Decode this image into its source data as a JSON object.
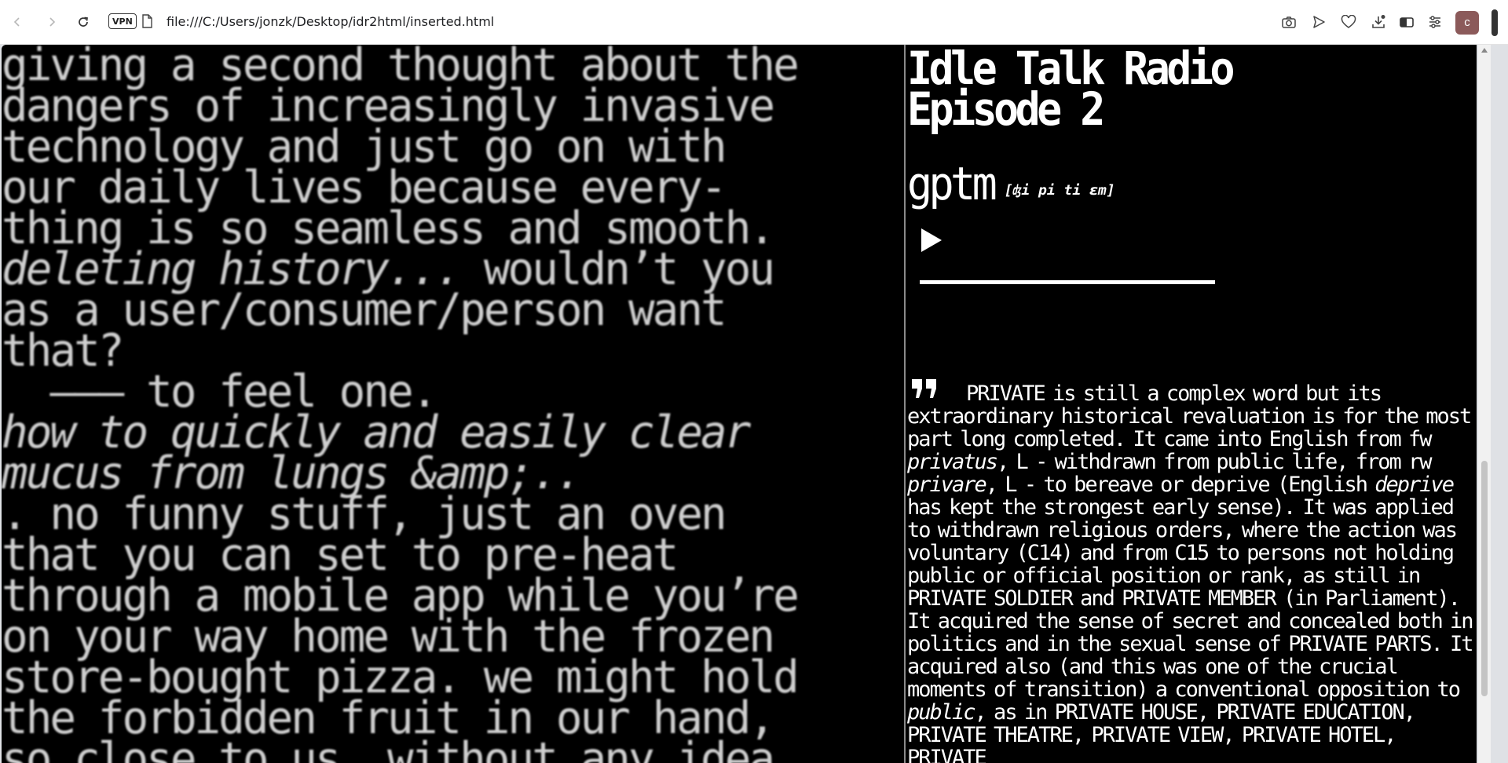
{
  "browser": {
    "vpn_label": "VPN",
    "url": "file:///C:/Users/jonzk/Desktop/idr2html/inserted.html",
    "profile_initial": "c"
  },
  "left": {
    "lines": [
      {
        "text": "giving a second thought about the",
        "italic": false
      },
      {
        "text": "dangers of increasingly invasive",
        "italic": false
      },
      {
        "text": "technology and just go on with",
        "italic": false
      },
      {
        "text": "our daily lives because every-",
        "italic": false
      },
      {
        "text": "thing is so seamless and smooth.",
        "italic": false
      },
      {
        "text": "deleting history...",
        "italic": true,
        "rest": " wouldn’t you"
      },
      {
        "text": "as a user/consumer/person want",
        "italic": false
      },
      {
        "text": "that?",
        "italic": false
      },
      {
        "text": "  ——— to feel one.",
        "italic": false
      },
      {
        "text": "how to quickly and easily clear",
        "italic": true
      },
      {
        "text": "mucus from lungs &amp;..",
        "italic": true
      },
      {
        "text": ". no funny stuff, just an oven",
        "italic": false
      },
      {
        "text": "that you can set to pre-heat",
        "italic": false
      },
      {
        "text": "through a mobile app while you’re",
        "italic": false
      },
      {
        "text": "on your way home with the frozen",
        "italic": false
      },
      {
        "text": "store-bought pizza. we might hold",
        "italic": false
      },
      {
        "text": "the forbidden fruit in our hand,",
        "italic": false
      },
      {
        "text": "so close to us, without any idea",
        "italic": false
      }
    ]
  },
  "right": {
    "title_line1": "Idle Talk Radio",
    "title_line2": "Episode 2",
    "speaker": "gptm",
    "pronunciation": "[ʤi pi ti ɛm]",
    "player": {
      "progress": 0
    },
    "quote": {
      "p1": "PRIVATE is still a complex word but its extraordinary historical revaluation is for the most part long completed. It came into English from fw ",
      "i1": "privatus",
      "p2": ", L - withdrawn from public life, from rw ",
      "i2": "privare",
      "p3": ", L - to bereave or deprive (English ",
      "i3": "deprive",
      "p4": " has kept the strongest early sense). It was applied to withdrawn religious orders, where the action was voluntary (C14) and from C15 to persons not holding public or official position or rank, as still in PRIVATE SOLDIER and PRIVATE MEMBER (in Parliament). It acquired the sense of secret and concealed both in politics and in the sexual sense of PRIVATE PARTS. It acquired also (and this was one of the crucial moments of transition) a conventional opposition to ",
      "i4": "public",
      "p5": ", as in PRIVATE HOUSE, PRIVATE EDUCATION, PRIVATE THEATRE, PRIVATE VIEW, PRIVATE HOTEL, PRIVATE"
    }
  }
}
